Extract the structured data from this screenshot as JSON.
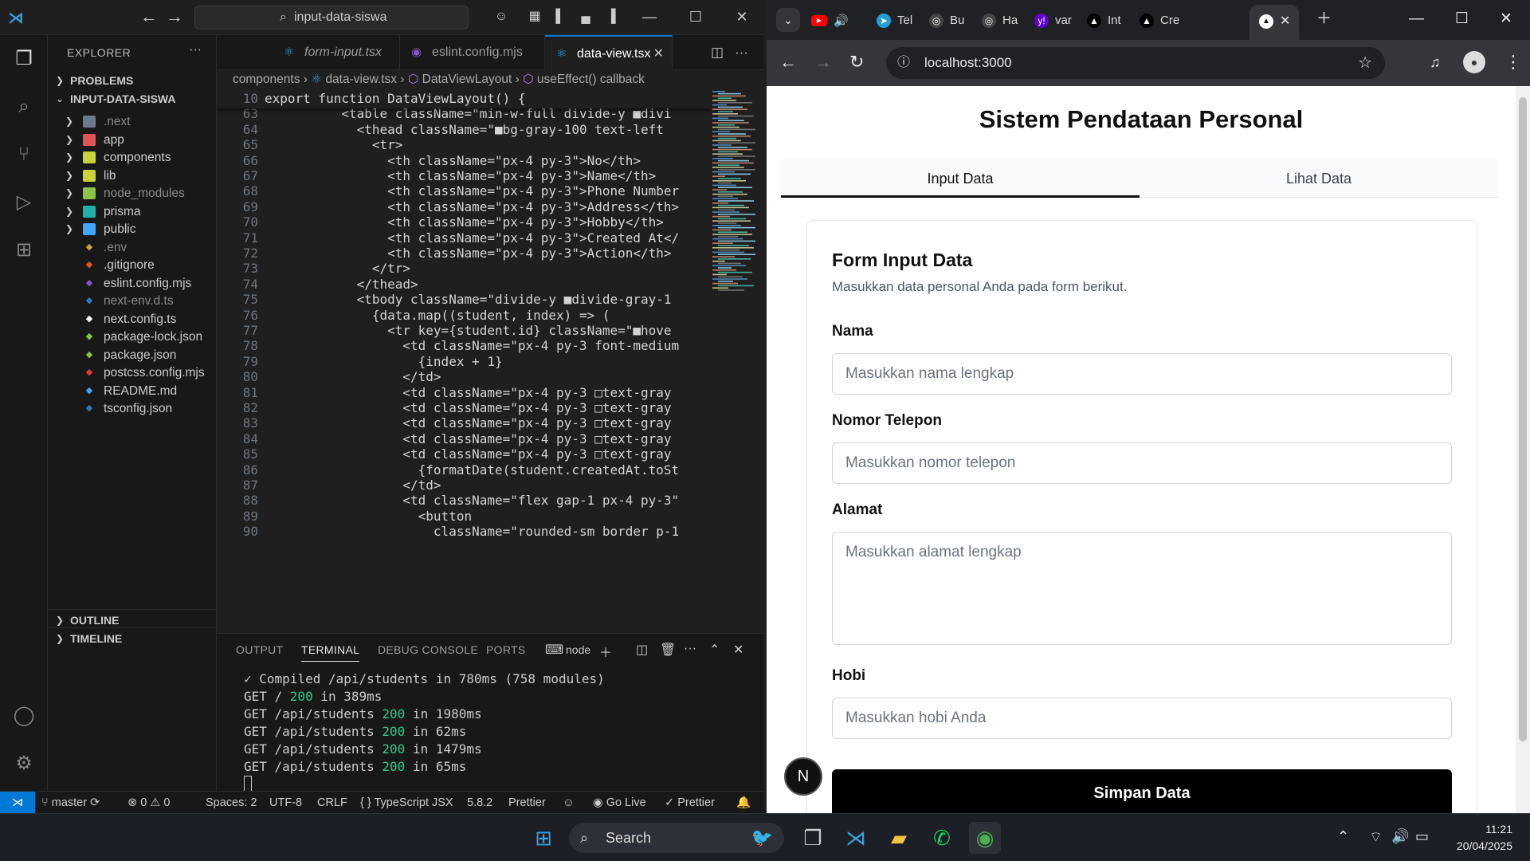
{
  "vscode": {
    "search_text": "input-data-siswa",
    "explorer_title": "EXPLORER",
    "sections": {
      "problems": "PROBLEMS",
      "project": "INPUT-DATA-SISWA",
      "outline": "OUTLINE",
      "timeline": "TIMELINE"
    },
    "tree": [
      {
        "name": ".next",
        "folder": true,
        "dim": true,
        "color": "#6b7b8c"
      },
      {
        "name": "app",
        "folder": true,
        "dim": false,
        "color": "#e0565b"
      },
      {
        "name": "components",
        "folder": true,
        "dim": false,
        "color": "#c8d33b"
      },
      {
        "name": "lib",
        "folder": true,
        "dim": false,
        "color": "#c8d33b"
      },
      {
        "name": "node_modules",
        "folder": true,
        "dim": true,
        "color": "#8bc34a"
      },
      {
        "name": "prisma",
        "folder": true,
        "dim": false,
        "color": "#20b2aa"
      },
      {
        "name": "public",
        "folder": true,
        "dim": false,
        "color": "#42a5f5"
      },
      {
        "name": ".env",
        "folder": false,
        "dim": true,
        "color": "#c8a640"
      },
      {
        "name": ".gitignore",
        "folder": false,
        "dim": false,
        "color": "#f4511e"
      },
      {
        "name": "eslint.config.mjs",
        "folder": false,
        "dim": false,
        "color": "#7e57c2"
      },
      {
        "name": "next-env.d.ts",
        "folder": false,
        "dim": true,
        "color": "#3178c6"
      },
      {
        "name": "next.config.ts",
        "folder": false,
        "dim": false,
        "color": "#ffffff"
      },
      {
        "name": "package-lock.json",
        "folder": false,
        "dim": false,
        "color": "#8bc34a"
      },
      {
        "name": "package.json",
        "folder": false,
        "dim": false,
        "color": "#8bc34a"
      },
      {
        "name": "postcss.config.mjs",
        "folder": false,
        "dim": false,
        "color": "#e53935"
      },
      {
        "name": "README.md",
        "folder": false,
        "dim": false,
        "color": "#42a5f5"
      },
      {
        "name": "tsconfig.json",
        "folder": false,
        "dim": false,
        "color": "#3178c6"
      }
    ],
    "tabs": [
      {
        "label": "form-input.tsx",
        "active": false
      },
      {
        "label": "eslint.config.mjs",
        "active": false
      },
      {
        "label": "data-view.tsx",
        "active": true
      }
    ],
    "breadcrumb": [
      "components",
      "data-view.tsx",
      "DataViewLayout",
      "useEffect() callback"
    ],
    "code": [
      {
        "n": "10",
        "t": "export function DataViewLayout() {",
        "sticky": true
      },
      {
        "n": "63",
        "t": "          <table className=\"min-w-full divide-y ■divi"
      },
      {
        "n": "64",
        "t": "            <thead className=\"■bg-gray-100 text-left"
      },
      {
        "n": "65",
        "t": "              <tr>"
      },
      {
        "n": "66",
        "t": "                <th className=\"px-4 py-3\">No</th>"
      },
      {
        "n": "67",
        "t": "                <th className=\"px-4 py-3\">Name</th>"
      },
      {
        "n": "68",
        "t": "                <th className=\"px-4 py-3\">Phone Number"
      },
      {
        "n": "69",
        "t": "                <th className=\"px-4 py-3\">Address</th>"
      },
      {
        "n": "70",
        "t": "                <th className=\"px-4 py-3\">Hobby</th>"
      },
      {
        "n": "71",
        "t": "                <th className=\"px-4 py-3\">Created At</"
      },
      {
        "n": "72",
        "t": "                <th className=\"px-4 py-3\">Action</th>"
      },
      {
        "n": "73",
        "t": "              </tr>"
      },
      {
        "n": "74",
        "t": "            </thead>"
      },
      {
        "n": "75",
        "t": "            <tbody className=\"divide-y ■divide-gray-1"
      },
      {
        "n": "76",
        "t": "              {data.map((student, index) => ("
      },
      {
        "n": "77",
        "t": "                <tr key={student.id} className=\"■hove"
      },
      {
        "n": "78",
        "t": "                  <td className=\"px-4 py-3 font-medium"
      },
      {
        "n": "79",
        "t": "                    {index + 1}"
      },
      {
        "n": "80",
        "t": "                  </td>"
      },
      {
        "n": "81",
        "t": "                  <td className=\"px-4 py-3 □text-gray"
      },
      {
        "n": "82",
        "t": "                  <td className=\"px-4 py-3 □text-gray"
      },
      {
        "n": "83",
        "t": "                  <td className=\"px-4 py-3 □text-gray"
      },
      {
        "n": "84",
        "t": "                  <td className=\"px-4 py-3 □text-gray"
      },
      {
        "n": "85",
        "t": "                  <td className=\"px-4 py-3 □text-gray"
      },
      {
        "n": "86",
        "t": "                    {formatDate(student.createdAt.toSt"
      },
      {
        "n": "87",
        "t": "                  </td>"
      },
      {
        "n": "88",
        "t": "                  <td className=\"flex gap-1 px-4 py-3\""
      },
      {
        "n": "89",
        "t": "                    <button"
      },
      {
        "n": "90",
        "t": "                      className=\"rounded-sm border p-1"
      }
    ],
    "panel_tabs": [
      "OUTPUT",
      "TERMINAL",
      "DEBUG CONSOLE",
      "PORTS"
    ],
    "terminal_shell": "node",
    "terminal": [
      {
        "pre": "✓ Compiled /api/students in 780ms (758 modules)",
        "code": "",
        "post": ""
      },
      {
        "pre": "GET / ",
        "code": "200",
        "post": " in 389ms"
      },
      {
        "pre": "GET /api/students ",
        "code": "200",
        "post": " in 1980ms"
      },
      {
        "pre": "GET /api/students ",
        "code": "200",
        "post": " in 62ms"
      },
      {
        "pre": "GET /api/students ",
        "code": "200",
        "post": " in 1479ms"
      },
      {
        "pre": "GET /api/students ",
        "code": "200",
        "post": " in 65ms"
      }
    ],
    "status": {
      "branch": "master",
      "errors": "0",
      "warnings": "0",
      "spaces": "Spaces: 2",
      "encoding": "UTF-8",
      "eol": "CRLF",
      "language": "TypeScript JSX",
      "ts_version": "5.8.2",
      "prettier1": "Prettier",
      "golive": "Go Live",
      "prettier2": "Prettier"
    }
  },
  "chrome": {
    "tabs": [
      {
        "title": "Tel",
        "color": "#229ed9",
        "glyph": "➤"
      },
      {
        "title": "Bu",
        "color": "#444",
        "glyph": "◎"
      },
      {
        "title": "Ha",
        "color": "#444",
        "glyph": "◎"
      },
      {
        "title": "var",
        "color": "#6001d2",
        "glyph": "y!"
      },
      {
        "title": "Int",
        "color": "#000",
        "glyph": "▲"
      },
      {
        "title": "Cre",
        "color": "#000",
        "glyph": "▲"
      }
    ],
    "url": "localhost:3000"
  },
  "app": {
    "title": "Sistem Pendataan Personal",
    "tabs": [
      "Input Data",
      "Lihat Data"
    ],
    "card_title": "Form Input Data",
    "card_desc": "Masukkan data personal Anda pada form berikut.",
    "fields": {
      "nama": {
        "label": "Nama",
        "placeholder": "Masukkan nama lengkap"
      },
      "telepon": {
        "label": "Nomor Telepon",
        "placeholder": "Masukkan nomor telepon"
      },
      "alamat": {
        "label": "Alamat",
        "placeholder": "Masukkan alamat lengkap"
      },
      "hobi": {
        "label": "Hobi",
        "placeholder": "Masukkan hobi Anda"
      }
    },
    "submit": "Simpan Data",
    "badge": "N"
  },
  "taskbar": {
    "search": "Search",
    "time": "11:21",
    "date": "20/04/2025"
  }
}
